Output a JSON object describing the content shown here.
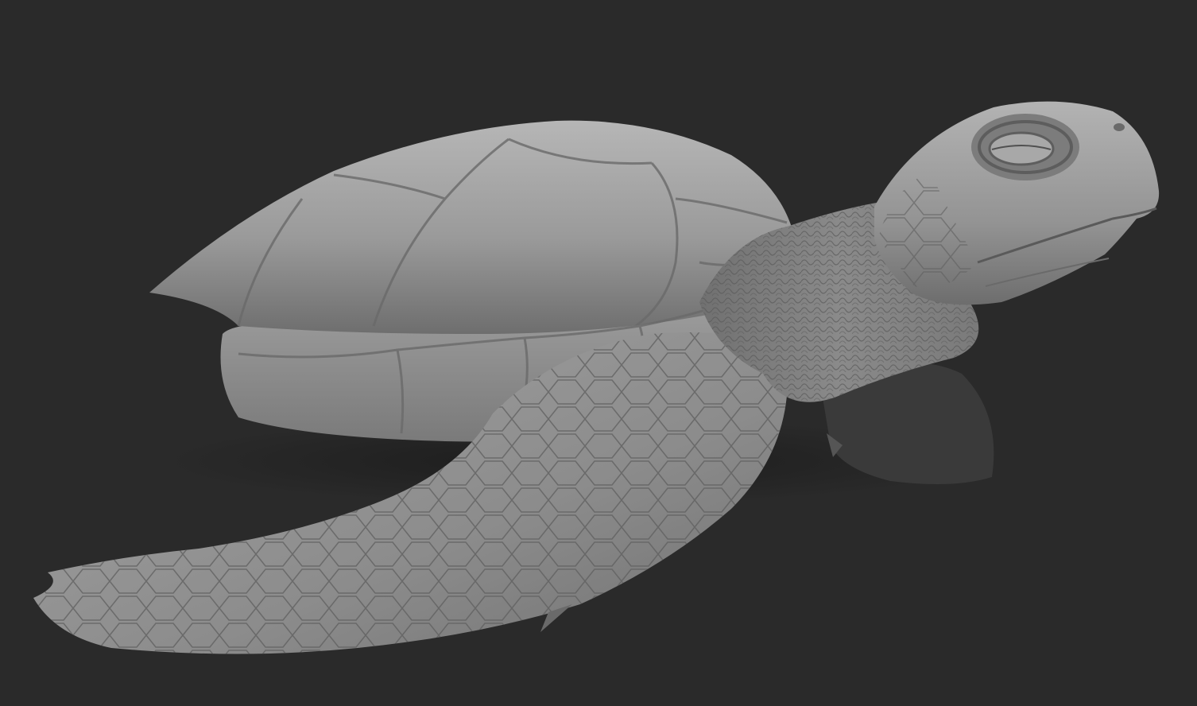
{
  "scene": {
    "subject": "sea-turtle-sculpt",
    "background_color": "#2a2a2a",
    "material": {
      "base": "#8e8e8e",
      "light": "#b8b8b8",
      "dark": "#4a4a4a"
    },
    "visible_text": []
  }
}
